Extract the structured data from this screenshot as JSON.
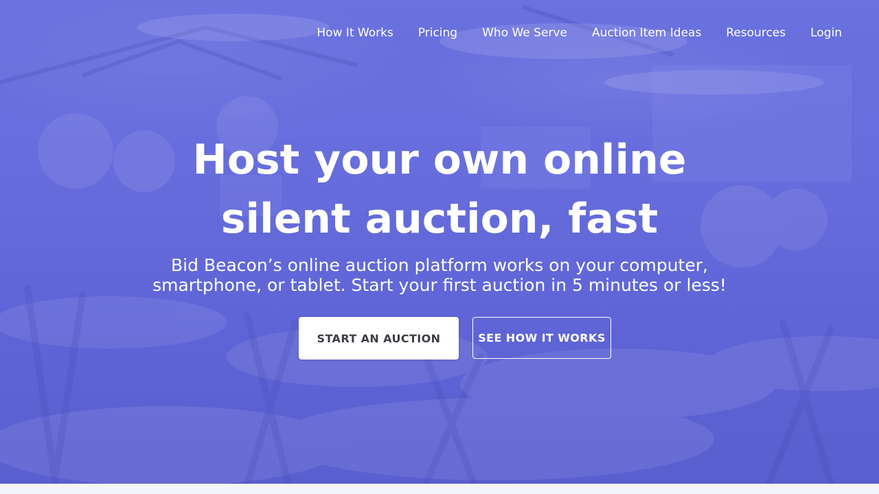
{
  "nav": {
    "items": [
      {
        "label": "How It Works"
      },
      {
        "label": "Pricing"
      },
      {
        "label": "Who We Serve"
      },
      {
        "label": "Auction Item Ideas"
      },
      {
        "label": "Resources"
      },
      {
        "label": "Login"
      }
    ]
  },
  "hero": {
    "headline": "Host your own online silent auction, fast",
    "subhead": "Bid Beacon’s online auction platform works on your computer, smartphone, or tablet. Start your first auction in 5 minutes or less!",
    "primary_cta": "START AN AUCTION",
    "secondary_cta": "SEE HOW IT WORKS"
  },
  "colors": {
    "hero_overlay": "#6a70dc",
    "button_primary_bg": "#ffffff",
    "button_primary_text": "#3c3c44",
    "page_bg": "#f4f5fb"
  }
}
